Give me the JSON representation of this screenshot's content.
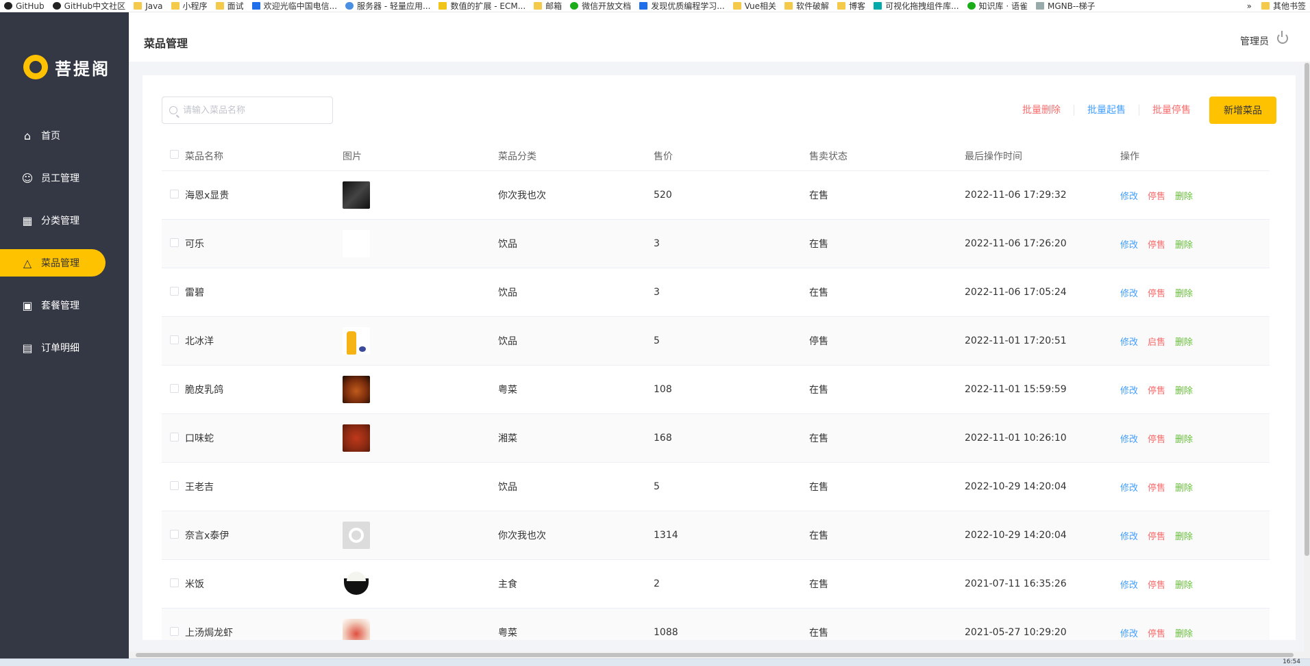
{
  "bookmarks": [
    {
      "label": "GitHub",
      "icon": "github-icon"
    },
    {
      "label": "GitHub中文社区",
      "icon": "github-icon"
    },
    {
      "label": "Java",
      "icon": "folder-icon"
    },
    {
      "label": "小程序",
      "icon": "folder-icon"
    },
    {
      "label": "面试",
      "icon": "folder-icon"
    },
    {
      "label": "欢迎光临中国电信...",
      "icon": "telecom-icon"
    },
    {
      "label": "服务器 - 轻量应用...",
      "icon": "cloud-icon"
    },
    {
      "label": "数值的扩展 - ECM...",
      "icon": "es-icon"
    },
    {
      "label": "邮箱",
      "icon": "folder-icon"
    },
    {
      "label": "微信开放文档",
      "icon": "wechat-icon"
    },
    {
      "label": "发现优质编程学习...",
      "icon": "code-icon"
    },
    {
      "label": "Vue相关",
      "icon": "folder-icon"
    },
    {
      "label": "软件破解",
      "icon": "folder-icon"
    },
    {
      "label": "博客",
      "icon": "folder-icon"
    },
    {
      "label": "可视化拖拽组件库...",
      "icon": "dragdrop-icon"
    },
    {
      "label": "知识库 · 语雀",
      "icon": "yuque-icon"
    },
    {
      "label": "MGNB--梯子",
      "icon": "link-icon"
    }
  ],
  "bookmarks_more": "»",
  "bookmarks_other": "其他书签",
  "sidebar": {
    "logo_text": "菩提阁",
    "items": [
      {
        "label": "首页",
        "icon": "home-icon",
        "active": false
      },
      {
        "label": "员工管理",
        "icon": "users-icon",
        "active": false
      },
      {
        "label": "分类管理",
        "icon": "grid-icon",
        "active": false
      },
      {
        "label": "菜品管理",
        "icon": "dish-icon",
        "active": true
      },
      {
        "label": "套餐管理",
        "icon": "package-icon",
        "active": false
      },
      {
        "label": "订单明细",
        "icon": "order-icon",
        "active": false
      }
    ]
  },
  "header": {
    "title": "菜品管理",
    "user": "管理员"
  },
  "search": {
    "placeholder": "请输入菜品名称"
  },
  "toolbar": {
    "batch_delete": "批量删除",
    "batch_on": "批量起售",
    "batch_off": "批量停售",
    "add": "新增菜品"
  },
  "table": {
    "headers": [
      "菜品名称",
      "图片",
      "菜品分类",
      "售价",
      "售卖状态",
      "最后操作时间",
      "操作"
    ],
    "rows": [
      {
        "name": "海恩x显贵",
        "image": "dark",
        "category": "你次我也次",
        "price": "520",
        "status": "在售",
        "time": "2022-11-06 17:29:32",
        "toggle": "停售"
      },
      {
        "name": "可乐",
        "image": "cola",
        "category": "饮品",
        "price": "3",
        "status": "在售",
        "time": "2022-11-06 17:26:20",
        "toggle": "停售"
      },
      {
        "name": "雷碧",
        "image": "sprite",
        "category": "饮品",
        "price": "3",
        "status": "在售",
        "time": "2022-11-06 17:05:24",
        "toggle": "停售"
      },
      {
        "name": "北冰洋",
        "image": "beibingyang",
        "category": "饮品",
        "price": "5",
        "status": "停售",
        "time": "2022-11-01 17:20:51",
        "toggle": "启售"
      },
      {
        "name": "脆皮乳鸽",
        "image": "food1",
        "category": "粤菜",
        "price": "108",
        "status": "在售",
        "time": "2022-11-01 15:59:59",
        "toggle": "停售"
      },
      {
        "name": "口味蛇",
        "image": "food2",
        "category": "湘菜",
        "price": "168",
        "status": "在售",
        "time": "2022-11-01 10:26:10",
        "toggle": "停售"
      },
      {
        "name": "王老吉",
        "image": "wanglaoji",
        "category": "饮品",
        "price": "5",
        "status": "在售",
        "time": "2022-10-29 14:20:04",
        "toggle": "停售"
      },
      {
        "name": "奈言x泰伊",
        "image": "logo",
        "category": "你次我也次",
        "price": "1314",
        "status": "在售",
        "time": "2022-10-29 14:20:04",
        "toggle": "停售"
      },
      {
        "name": "米饭",
        "image": "rice",
        "category": "主食",
        "price": "2",
        "status": "在售",
        "time": "2021-07-11 16:35:26",
        "toggle": "停售"
      },
      {
        "name": "上汤焗龙虾",
        "image": "lobster",
        "category": "粤菜",
        "price": "1088",
        "status": "在售",
        "time": "2021-05-27 10:29:20",
        "toggle": "停售"
      }
    ],
    "op_edit": "修改",
    "op_delete": "删除"
  },
  "taskbar": {
    "clock": "16:54"
  },
  "colors": {
    "sidebar_bg": "#343744",
    "accent": "#ffc200",
    "link_blue": "#419eff",
    "danger_red": "#f56c6c",
    "success_green": "#67c23a"
  }
}
